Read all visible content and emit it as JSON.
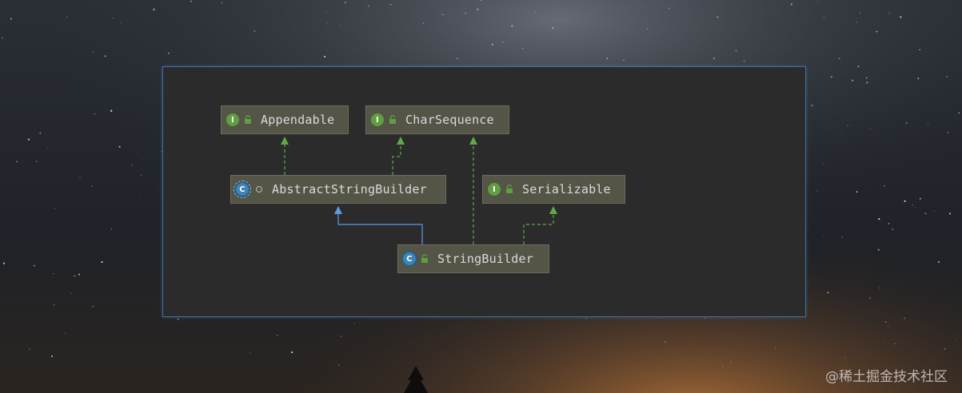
{
  "diagram": {
    "nodes": [
      {
        "id": "appendable",
        "kind": "interface",
        "kind_letter": "I",
        "visibility": "public",
        "label": "Appendable"
      },
      {
        "id": "charsequence",
        "kind": "interface",
        "kind_letter": "I",
        "visibility": "public",
        "label": "CharSequence"
      },
      {
        "id": "abstractstringbuilder",
        "kind": "abstract-class",
        "kind_letter": "C",
        "visibility": "package-private",
        "label": "AbstractStringBuilder"
      },
      {
        "id": "serializable",
        "kind": "interface",
        "kind_letter": "I",
        "visibility": "public",
        "label": "Serializable"
      },
      {
        "id": "stringbuilder",
        "kind": "final-class",
        "kind_letter": "C",
        "visibility": "public",
        "label": "StringBuilder"
      }
    ],
    "edges": [
      {
        "from": "abstractstringbuilder",
        "to": "appendable",
        "type": "implements",
        "style": "dashed",
        "color": "#62a84a"
      },
      {
        "from": "abstractstringbuilder",
        "to": "charsequence",
        "type": "implements",
        "style": "dashed",
        "color": "#62a84a"
      },
      {
        "from": "stringbuilder",
        "to": "abstractstringbuilder",
        "type": "extends",
        "style": "solid",
        "color": "#5b9be6"
      },
      {
        "from": "stringbuilder",
        "to": "charsequence",
        "type": "implements",
        "style": "dashed",
        "color": "#62a84a"
      },
      {
        "from": "stringbuilder",
        "to": "serializable",
        "type": "implements",
        "style": "dashed",
        "color": "#62a84a"
      }
    ]
  },
  "watermark": "@稀土掘金技术社区",
  "colors": {
    "panel": "#2b2b2b",
    "node_fill": "#545447",
    "interface_icon": "#5f9f3f",
    "class_icon": "#3c83b6",
    "implements_edge": "#62a84a",
    "extends_edge": "#5b9be6",
    "lock_icon": "#5f9f3f"
  }
}
